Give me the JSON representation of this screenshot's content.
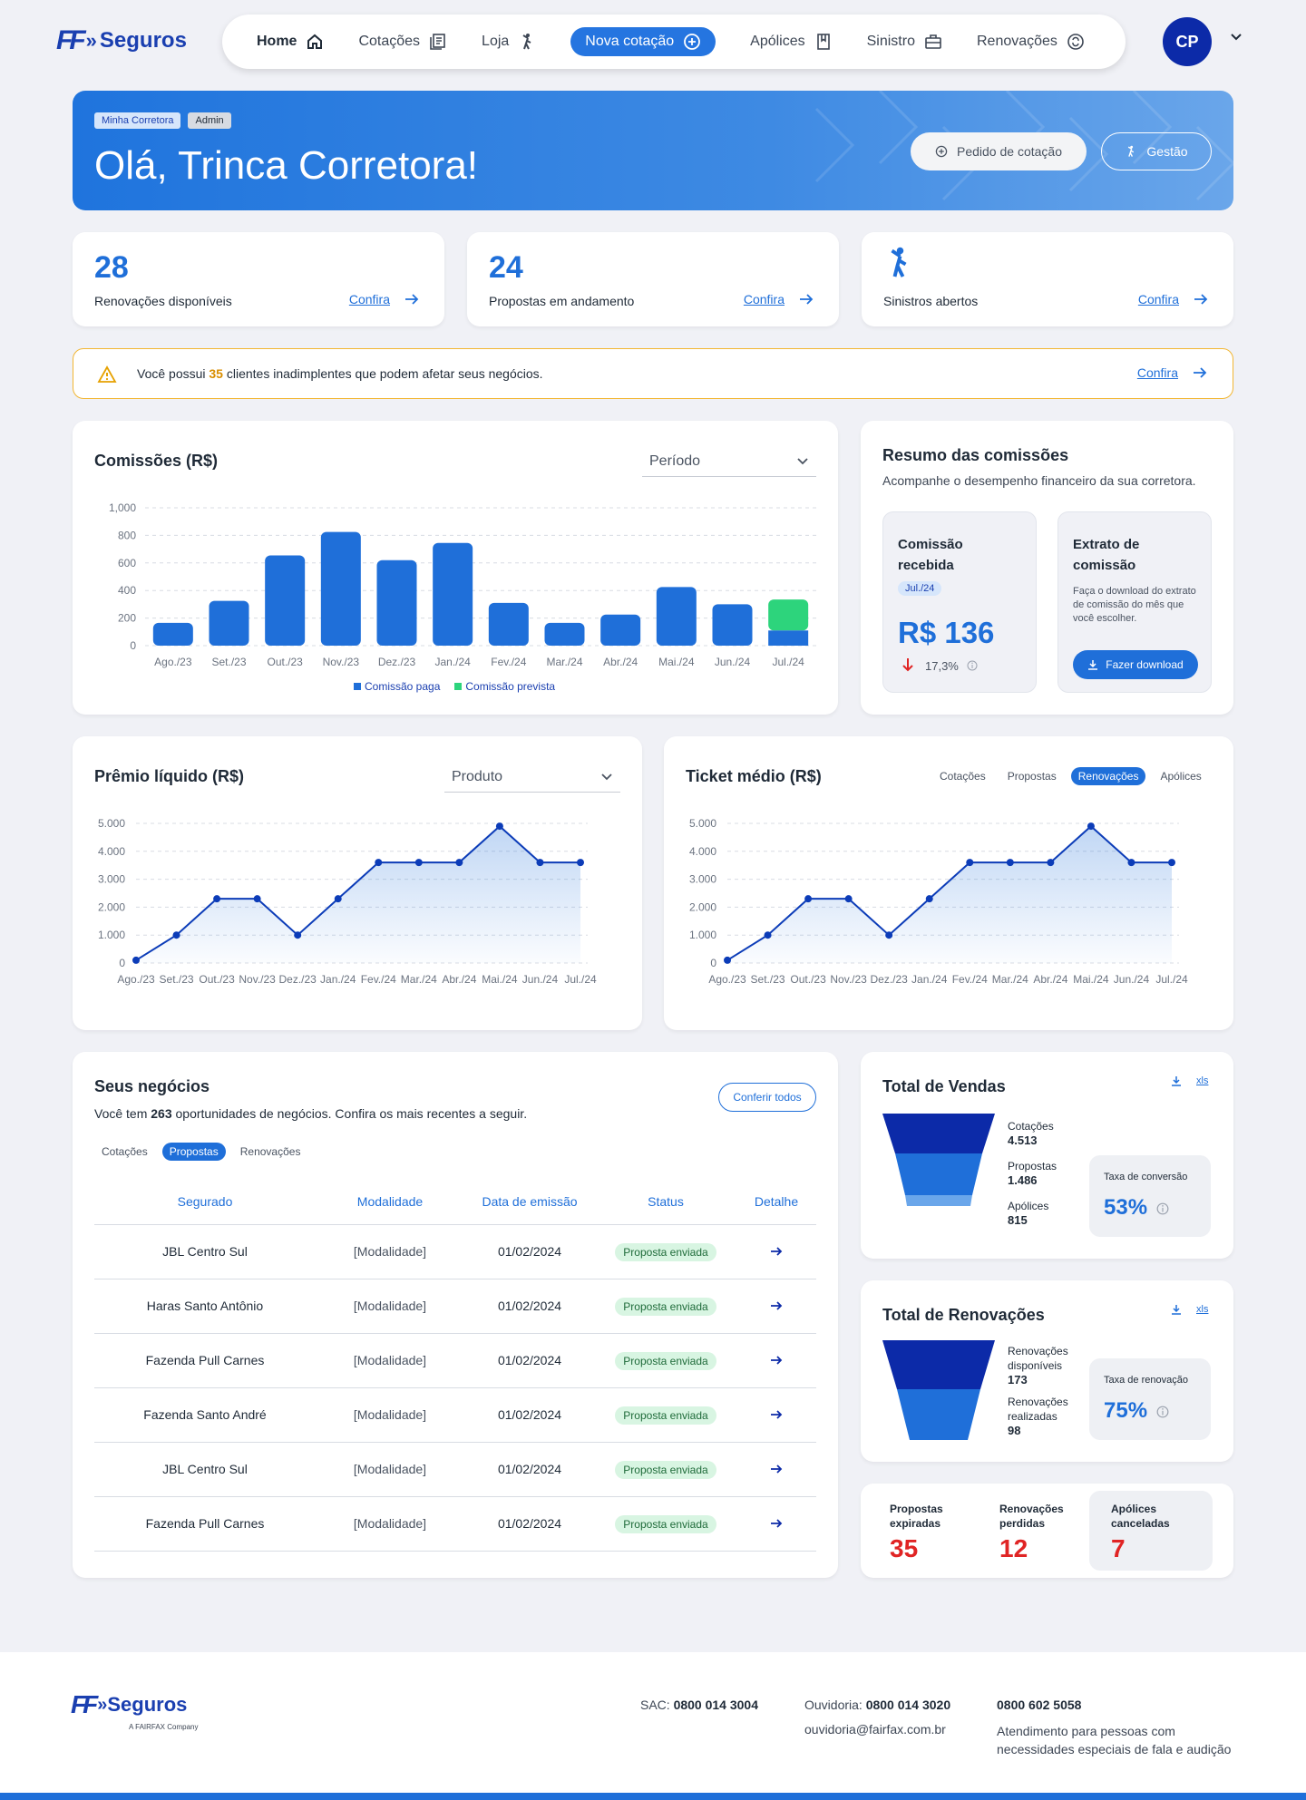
{
  "brand": {
    "ff": "FF",
    "name": "Seguros",
    "subtitle": "A FAIRFAX Company"
  },
  "nav": {
    "items": [
      {
        "label": "Home",
        "icon": "home-icon"
      },
      {
        "label": "Cotações",
        "icon": "document-icon"
      },
      {
        "label": "Loja",
        "icon": "person-icon"
      },
      {
        "label": "Nova cotação",
        "icon": "plus-circle-icon"
      },
      {
        "label": "Apólices",
        "icon": "bookmark-icon"
      },
      {
        "label": "Sinistro",
        "icon": "briefcase-icon"
      },
      {
        "label": "Renovações",
        "icon": "renew-icon"
      }
    ],
    "avatar": "CP"
  },
  "hero": {
    "tag1": "Minha Corretora",
    "tag2": "Admin",
    "greeting": "Olá, Trinca Corretora!",
    "btn_quote": "Pedido de cotação",
    "btn_manage": "Gestão"
  },
  "stats": [
    {
      "value": "28",
      "label": "Renovações disponíveis",
      "link": "Confira"
    },
    {
      "value": "24",
      "label": "Propostas em andamento",
      "link": "Confira"
    },
    {
      "value": "",
      "label": "Sinistros abertos",
      "link": "Confira"
    }
  ],
  "alert": {
    "prefix": "Você possui ",
    "count": "35",
    "suffix": " clientes inadimplentes que podem afetar seus negócios.",
    "link": "Confira"
  },
  "commissions": {
    "title": "Comissões (R$)",
    "select": "Período",
    "legend_paid": "Comissão paga",
    "legend_forecast": "Comissão prevista"
  },
  "summary": {
    "title": "Resumo das comissões",
    "subtitle": "Acompanhe o desempenho financeiro da sua corretora.",
    "received_title": "Comissão recebida",
    "received_period": "Jul./24",
    "received_value": "R$ 136",
    "received_change": "17,3%",
    "statement_title": "Extrato de comissão",
    "statement_text": "Faça o download do extrato de comissão do mês que você escolher.",
    "download": "Fazer download"
  },
  "premium": {
    "title": "Prêmio líquido (R$)",
    "select": "Produto"
  },
  "ticket": {
    "title": "Ticket médio (R$)",
    "tabs": [
      "Cotações",
      "Propostas",
      "Renovações",
      "Apólices"
    ],
    "active": 2
  },
  "business": {
    "title": "Seus negócios",
    "text_pre": "Você tem ",
    "count": "263",
    "text_post": " oportunidades de negócios. Confira os mais recentes a seguir.",
    "btn": "Conferir todos",
    "tabs": [
      "Cotações",
      "Propostas",
      "Renovações"
    ],
    "active": 1,
    "columns": [
      "Segurado",
      "Modalidade",
      "Data de emissão",
      "Status",
      "Detalhe"
    ],
    "rows": [
      [
        "JBL Centro Sul",
        "[Modalidade]",
        "01/02/2024",
        "Proposta enviada"
      ],
      [
        "Haras Santo Antônio",
        "[Modalidade]",
        "01/02/2024",
        "Proposta enviada"
      ],
      [
        "Fazenda Pull Carnes",
        "[Modalidade]",
        "01/02/2024",
        "Proposta enviada"
      ],
      [
        "Fazenda Santo André",
        "[Modalidade]",
        "01/02/2024",
        "Proposta enviada"
      ],
      [
        "JBL Centro Sul",
        "[Modalidade]",
        "01/02/2024",
        "Proposta enviada"
      ],
      [
        "Fazenda Pull Carnes",
        "[Modalidade]",
        "01/02/2024",
        "Proposta enviada"
      ]
    ]
  },
  "sales": {
    "title": "Total de Vendas",
    "xls": "xls",
    "items": [
      {
        "label": "Cotações",
        "value": "4.513"
      },
      {
        "label": "Propostas",
        "value": "1.486"
      },
      {
        "label": "Apólices",
        "value": "815"
      }
    ],
    "rate_label": "Taxa de conversão",
    "rate": "53%"
  },
  "renewals": {
    "title": "Total de Renovações",
    "xls": "xls",
    "items": [
      {
        "label": "Renovações disponíveis",
        "value": "173"
      },
      {
        "label": "Renovações realizadas",
        "value": "98"
      }
    ],
    "rate_label": "Taxa de renovação",
    "rate": "75%"
  },
  "losses": [
    {
      "label": "Propostas expiradas",
      "value": "35"
    },
    {
      "label": "Renovações perdidas",
      "value": "12"
    },
    {
      "label": "Apólices canceladas",
      "value": "7"
    }
  ],
  "footer": {
    "sac_label": "SAC:",
    "sac": "0800 014 3004",
    "ouv_label": "Ouvidoria:",
    "ouv": "0800 014 3020",
    "ouv_email": "ouvidoria@fairfax.com.br",
    "special": "0800 602 5058",
    "special_text": "Atendimento para pessoas com necessidades especiais de fala e audição"
  },
  "colors": {
    "primary": "#1f6fd9",
    "dark": "#0c2aa8",
    "green": "#2dd47c",
    "red": "#e02424"
  },
  "chart_data": [
    {
      "type": "bar",
      "title": "Comissões (R$)",
      "categories": [
        "Ago./23",
        "Set./23",
        "Out./23",
        "Nov./23",
        "Dez./23",
        "Jan./24",
        "Fev./24",
        "Mar./24",
        "Abr./24",
        "Mai./24",
        "Jun./24",
        "Jul./24"
      ],
      "series": [
        {
          "name": "Comissão paga",
          "values": [
            165,
            325,
            655,
            825,
            620,
            745,
            310,
            165,
            225,
            425,
            300,
            110
          ]
        },
        {
          "name": "Comissão prevista",
          "values": [
            0,
            0,
            0,
            0,
            0,
            0,
            0,
            0,
            0,
            0,
            0,
            225
          ]
        }
      ],
      "ylim": [
        0,
        1000
      ],
      "yticks": [
        0,
        200,
        400,
        600,
        800,
        1000
      ],
      "legend": "bottom",
      "grid": true
    },
    {
      "type": "area",
      "title": "Prêmio líquido (R$)",
      "categories": [
        "Ago./23",
        "Set./23",
        "Out./23",
        "Nov./23",
        "Dez./23",
        "Jan./24",
        "Fev./24",
        "Mar./24",
        "Abr./24",
        "Mai./24",
        "Jun./24",
        "Jul./24"
      ],
      "values": [
        100,
        1000,
        2300,
        2300,
        1000,
        2300,
        3600,
        3600,
        3600,
        4900,
        3600,
        3600
      ],
      "ylim": [
        0,
        5000
      ],
      "yticks": [
        "0",
        "1.000",
        "2.000",
        "3.000",
        "4.000",
        "5.000"
      ],
      "grid": true
    },
    {
      "type": "area",
      "title": "Ticket médio (R$)",
      "categories": [
        "Ago./23",
        "Set./23",
        "Out./23",
        "Nov./23",
        "Dez./23",
        "Jan./24",
        "Fev./24",
        "Mar./24",
        "Abr./24",
        "Mai./24",
        "Jun./24",
        "Jul./24"
      ],
      "values": [
        100,
        1000,
        2300,
        2300,
        1000,
        2300,
        3600,
        3600,
        3600,
        4900,
        3600,
        3600
      ],
      "ylim": [
        0,
        5000
      ],
      "yticks": [
        "0",
        "1.000",
        "2.000",
        "3.000",
        "4.000",
        "5.000"
      ],
      "grid": true
    }
  ]
}
